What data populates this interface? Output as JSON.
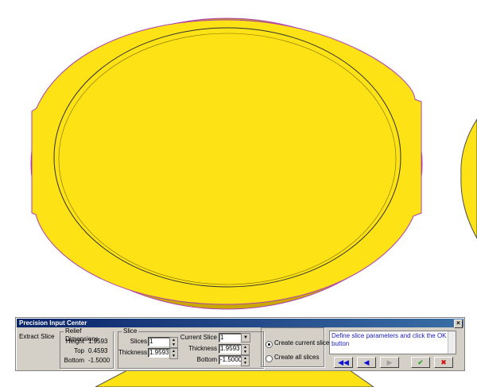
{
  "colors": {
    "model_fill": "#fde215",
    "model_edge": "#c8a800",
    "accent_title": "#0a246a"
  },
  "panel": {
    "title": "Precision Input Center",
    "close_icon": "×",
    "extract_slice_label": "Extract Slice",
    "relief_dimensions": {
      "title": "Relief Dimensions",
      "height_label": "Height",
      "height_value": "1.9593",
      "top_label": "Top",
      "top_value": "0.4593",
      "bottom_label": "Bottom",
      "bottom_value": "-1.5000"
    },
    "slice": {
      "title": "Slice",
      "slices_label": "Slices",
      "slices_value": "1",
      "thickness_label": "Thickness",
      "thickness_value": "1.9593"
    },
    "current_slice": {
      "label": "Current Slice",
      "value": "1",
      "thickness_label": "Thickness",
      "thickness_value": "1.9593",
      "bottom_label": "Bottom",
      "bottom_value": "-1.5000"
    },
    "create_mode": {
      "current_label": "Create current slice",
      "all_label": "Create all slices",
      "selected": "current"
    },
    "message": "Define slice parameters and click the OK button",
    "buttons": {
      "first_icon": "◀◀",
      "prev_icon": "◀",
      "next_icon": "▶",
      "ok_icon": "✔",
      "cancel_icon": "✖"
    }
  }
}
